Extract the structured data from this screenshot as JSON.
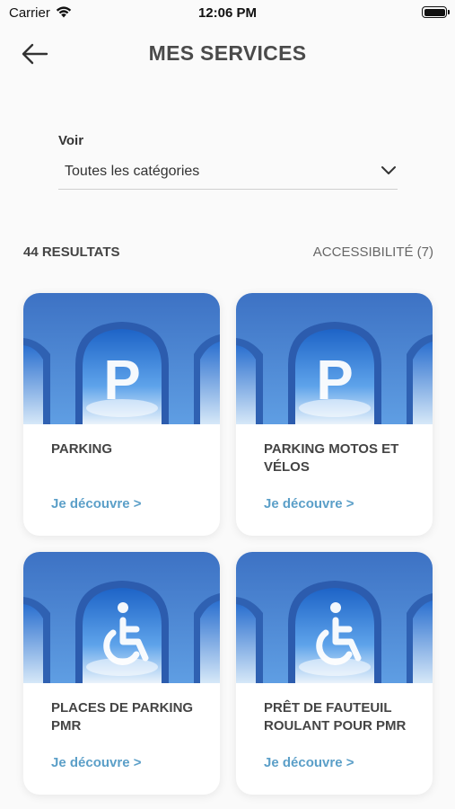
{
  "status_bar": {
    "carrier": "Carrier",
    "time": "12:06 PM"
  },
  "header": {
    "title": "MES SERVICES",
    "back_icon": "arrow-left-icon"
  },
  "filter": {
    "label": "Voir",
    "selected": "Toutes les catégories",
    "icon": "chevron-down-icon"
  },
  "results": {
    "count_label": "44 RESULTATS",
    "active_filter": "ACCESSIBILITÉ (7)"
  },
  "services": [
    {
      "title": "PARKING",
      "link": "Je découvre >",
      "image_icon": "parking-icon"
    },
    {
      "title": "PARKING MOTOS ET VÉLOS",
      "link": "Je découvre >",
      "image_icon": "parking-icon"
    },
    {
      "title": "PLACES DE PARKING PMR",
      "link": "Je découvre >",
      "image_icon": "wheelchair-icon"
    },
    {
      "title": "PRÊT DE FAUTEUIL ROULANT POUR PMR",
      "link": "Je découvre >",
      "image_icon": "wheelchair-icon"
    }
  ],
  "colors": {
    "link": "#5b9fc8",
    "sky": "#3b76c8",
    "wall": "#4f8ed9"
  }
}
